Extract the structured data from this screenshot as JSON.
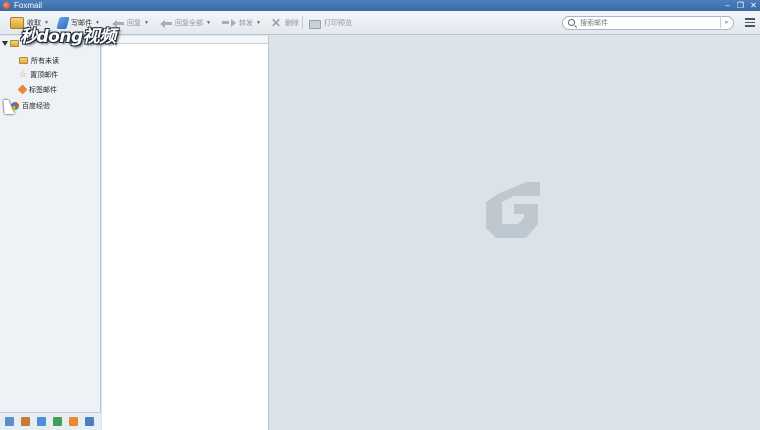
{
  "window": {
    "title": "Foxmail",
    "controls": [
      "minimize-icon",
      "restore-icon",
      "close-icon"
    ]
  },
  "toolbar": {
    "inbox_label": "收取",
    "write_label": "写邮件",
    "reply_label": "回复",
    "reply_all_label": "回复全部",
    "forward_label": "转发",
    "delete_label": "删除",
    "print_label": "打印预览"
  },
  "search": {
    "placeholder": "搜索邮件"
  },
  "folders": {
    "items": [
      {
        "label": "所有未读",
        "icon": "folder-icon"
      },
      {
        "label": "置顶邮件",
        "icon": "star-icon"
      },
      {
        "label": "标签邮件",
        "icon": "tag-icon"
      },
      {
        "label": "百度经验",
        "icon": "baidu-icon"
      }
    ],
    "bottom_icons": [
      "mail-icon",
      "contacts-icon",
      "calendar-icon",
      "notes-icon",
      "rss-icon",
      "settings-icon"
    ]
  },
  "watermark": {
    "text": "秒dong视频"
  },
  "colors": {
    "titlebar": "#3a6aa6",
    "reading_pane": "#dbe3e8",
    "logo": "#b8c3cc"
  }
}
